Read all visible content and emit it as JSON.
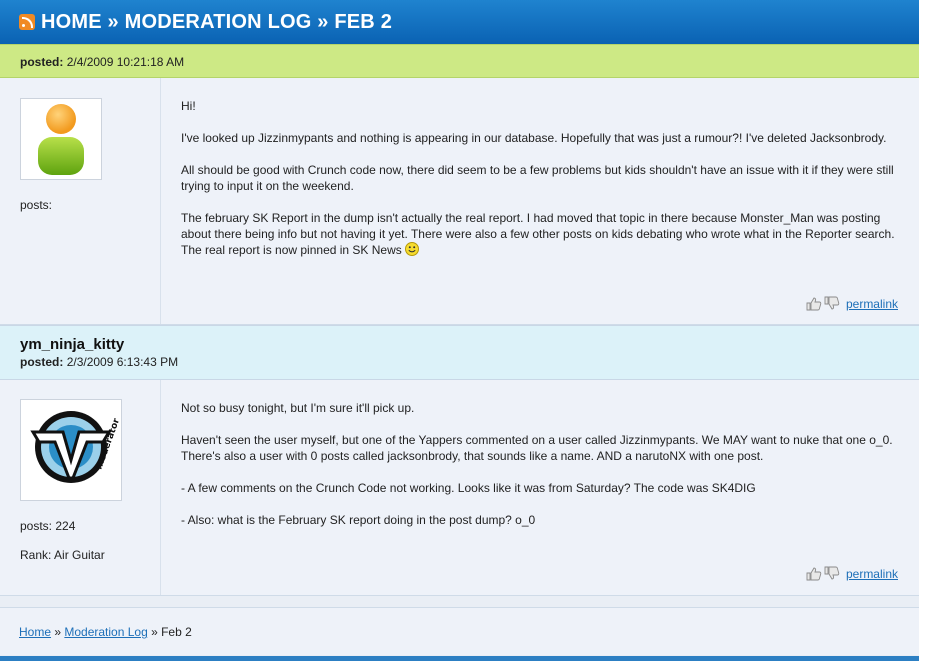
{
  "header": {
    "title": "HOME » MODERATION LOG » FEB 2",
    "feed_icon": "rss-icon"
  },
  "posts": [
    {
      "author": "",
      "posted_label": "posted:",
      "posted_date": "2/4/2009 10:21:18 AM",
      "avatar": "generic-user-avatar",
      "posts_label": "posts:",
      "posts_count": "",
      "rank": "",
      "paragraphs": [
        "Hi!",
        "I've looked up Jizzinmypants and nothing is appearing in our database. Hopefully that was just a rumour?! I've deleted Jacksonbrody.",
        "All should be good with Crunch code now, there did seem to be a few problems but kids shouldn't have an issue with it if they were still trying to input it on the weekend.",
        "The february SK Report in the dump isn't actually the real report. I had moved that topic in there because Monster_Man was posting about there being info but not having it yet. There were also a few other posts on kids debating who wrote what in the Reporter search. The real report is now pinned in SK News"
      ],
      "permalink": "permalink"
    },
    {
      "author": "ym_ninja_kitty",
      "posted_label": "posted:",
      "posted_date": "2/3/2009 6:13:43 PM",
      "avatar": "yt-moderator-avatar",
      "avatar_text": "moderator",
      "posts_label": "posts:",
      "posts_count": "224",
      "rank": "Rank: Air Guitar",
      "paragraphs": [
        "Not so busy tonight, but I'm sure it'll pick up.",
        "Haven't seen the user myself, but one of the Yappers commented on a user called Jizzinmypants. We MAY want to nuke that one o_0. There's also a user with 0 posts called jacksonbrody, that sounds like a name. AND a narutoNX with one post.",
        "- A few comments on the Crunch Code not working. Looks like it was from Saturday? The code was SK4DIG",
        "- Also: what is the February SK report doing in the post dump? o_0"
      ],
      "permalink": "permalink"
    }
  ],
  "breadcrumb": {
    "home": "Home",
    "sep1": " » ",
    "moderation_log": "Moderation Log",
    "sep2": " » ",
    "current": "Feb 2"
  },
  "colors": {
    "header": "#0a62b3",
    "post_head_green": "#cde985",
    "post_head_cyan": "#dcf2f9",
    "link": "#1d6fb8"
  }
}
